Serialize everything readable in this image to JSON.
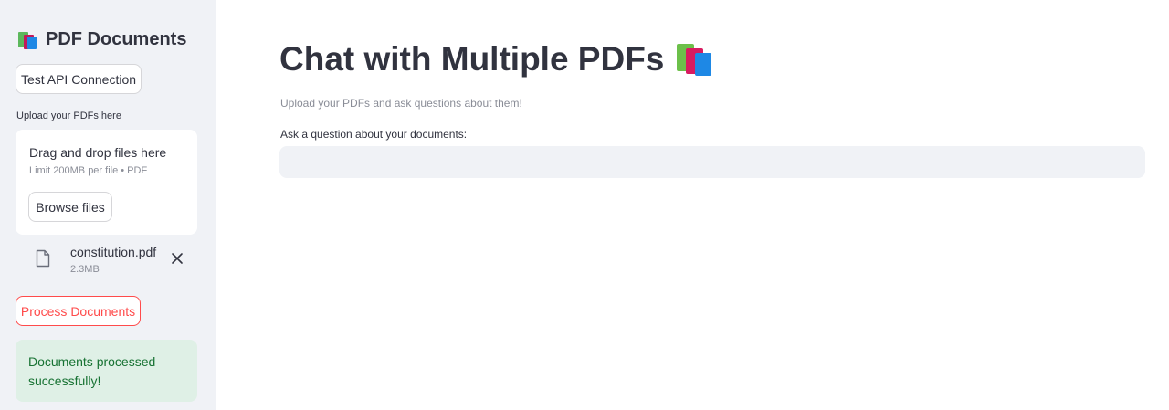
{
  "sidebar": {
    "title": "PDF Documents",
    "title_icon": "books-icon",
    "test_api_label": "Test API Connection",
    "upload_label": "Upload your PDFs here",
    "dropzone": {
      "title": "Drag and drop files here",
      "limit": "Limit 200MB per file • PDF",
      "browse_label": "Browse files"
    },
    "file": {
      "name": "constitution.pdf",
      "size": "2.3MB",
      "icon": "file-icon",
      "remove_icon": "close-icon"
    },
    "process_label": "Process Documents",
    "success_message": "Documents processed successfully!"
  },
  "main": {
    "title": "Chat with Multiple PDFs",
    "title_icon": "books-icon",
    "subtitle": "Upload your PDFs and ask questions about them!",
    "question_label": "Ask a question about your documents:",
    "question_value": ""
  },
  "colors": {
    "sidebar_bg": "#f0f2f6",
    "accent": "#ff4b4b",
    "success_bg": "#dff0e6",
    "success_text": "#177233"
  }
}
